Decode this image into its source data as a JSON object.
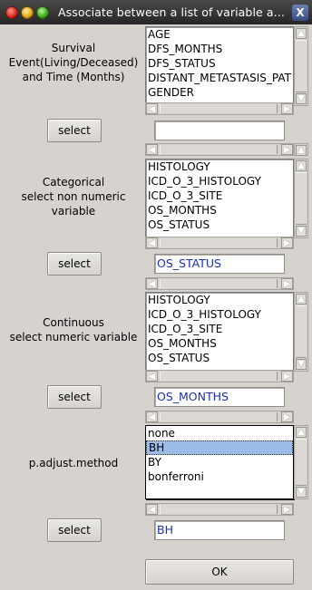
{
  "window": {
    "title": "Associate between a list of variable a...",
    "close_glyph": "X"
  },
  "section1": {
    "label": "Survival\nEvent(Living/Deceased)\nand Time (Months)",
    "items": [
      "AGE",
      "DFS_MONTHS",
      "DFS_STATUS",
      "DISTANT_METASTASIS_PAT",
      "GENDER"
    ],
    "select_label": "select",
    "value": ""
  },
  "section2": {
    "label": "Categorical\nselect non numeric\nvariable",
    "items": [
      "HISTOLOGY",
      "ICD_O_3_HISTOLOGY",
      "ICD_O_3_SITE",
      "OS_MONTHS",
      "OS_STATUS"
    ],
    "select_label": "select",
    "value": "OS_STATUS"
  },
  "section3": {
    "label": "Continuous\nselect numeric variable",
    "items": [
      "HISTOLOGY",
      "ICD_O_3_HISTOLOGY",
      "ICD_O_3_SITE",
      "OS_MONTHS",
      "OS_STATUS"
    ],
    "select_label": "select",
    "value": "OS_MONTHS"
  },
  "section4": {
    "label": "p.adjust.method",
    "items": [
      "none",
      "BH",
      "BY",
      "bonferroni"
    ],
    "selected": "BH",
    "select_label": "select",
    "value": "BH"
  },
  "ok_label": "OK",
  "colors": {
    "field_text": "#1a2fb8",
    "selection": "#9cbde8",
    "background": "#d6d3ce"
  }
}
